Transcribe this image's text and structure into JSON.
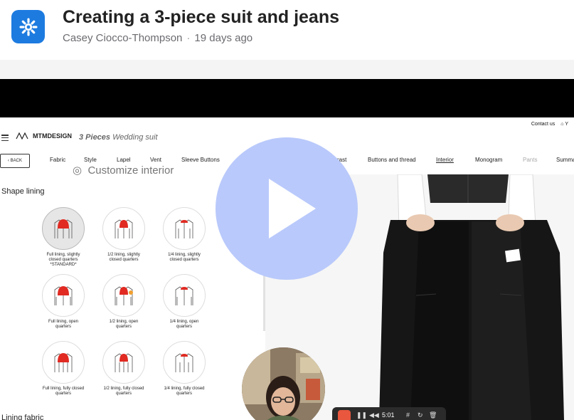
{
  "header": {
    "logo_icon": "snowflake-gear-icon",
    "title": "Creating a 3-piece suit and jeans",
    "author": "Casey Ciocco-Thompson",
    "separator": "·",
    "age": "19 days ago"
  },
  "site": {
    "contact_link": "Contact us",
    "brand": "MTMDESIGN",
    "suit_count": "3 Pieces",
    "suit_name": "Wedding suit",
    "back_label": "BACK"
  },
  "nav": {
    "fabric": "Fabric",
    "style": "Style",
    "lapel": "Lapel",
    "vent": "Vent",
    "sleeve_buttons": "Sleeve Buttons",
    "contrast": "rast",
    "buttons_thread": "Buttons and thread",
    "interior": "Interior",
    "monogram": "Monogram",
    "pants": "Pants",
    "summary": "Summa"
  },
  "customize": {
    "heading": "Customize interior",
    "shape_lining_label": "Shape lining",
    "lining_fabric_label": "Lining fabric",
    "options": [
      {
        "line1": "Full lining, slightly",
        "line2": "closed quarters",
        "line3": "*STANDARD*",
        "selected": true
      },
      {
        "line1": "1/2 lining, slightly",
        "line2": "closed quarters",
        "line3": "",
        "selected": false
      },
      {
        "line1": "1/4 lining, slightly",
        "line2": "closed quarters",
        "line3": "",
        "selected": false
      },
      {
        "line1": "Full lining, open",
        "line2": "quarters",
        "line3": "",
        "selected": false
      },
      {
        "line1": "1/2 lining, open",
        "line2": "quarters",
        "line3": "",
        "selected": false
      },
      {
        "line1": "1/4 lining, open",
        "line2": "quarters",
        "line3": "",
        "selected": false
      },
      {
        "line1": "Full lining, fully closed",
        "line2": "quarters",
        "line3": "",
        "selected": false
      },
      {
        "line1": "1/2 lining, fully closed",
        "line2": "quarters",
        "line3": "",
        "selected": false
      },
      {
        "line1": "1/4 lining, fully closed",
        "line2": "quarters",
        "line3": "",
        "selected": false
      }
    ]
  },
  "player": {
    "play_icon": "play-icon",
    "elapsed": "5:01",
    "stop_icon": "stop-icon",
    "pause_icon": "pause-icon",
    "rewind_icon": "rewind-icon",
    "grid_icon": "grid-icon",
    "restart_icon": "restart-icon",
    "delete_icon": "trash-icon"
  },
  "colors": {
    "brand_blue": "#1d7be0",
    "play_overlay": "#b9c9fb",
    "stop_red": "#e8573e"
  }
}
